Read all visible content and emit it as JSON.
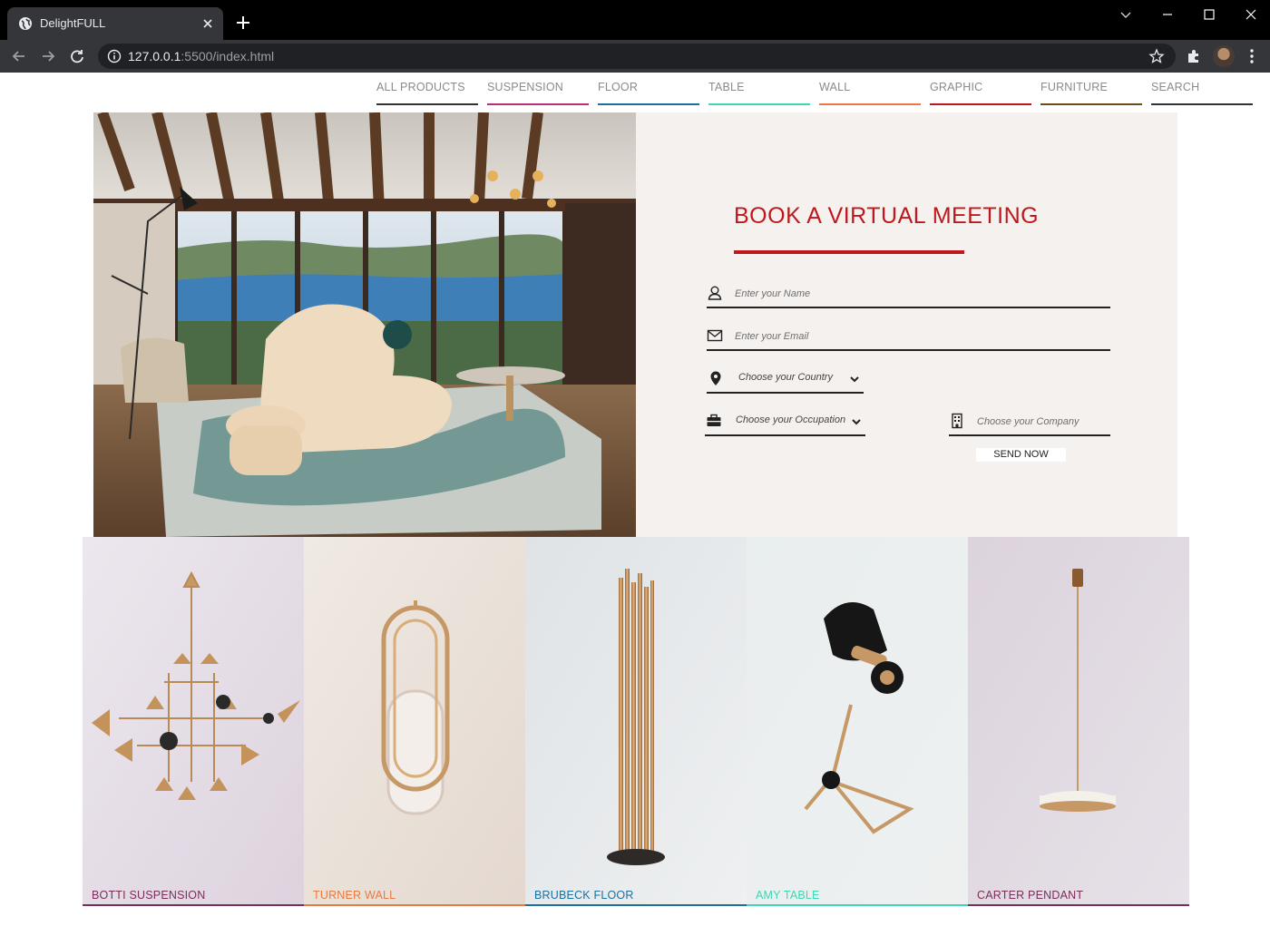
{
  "browser": {
    "tab_title": "DelightFULL",
    "url_host": "127.0.0.1",
    "url_rest": ":5500/index.html"
  },
  "nav": {
    "items": [
      {
        "label": "ALL PRODUCTS",
        "color": "#333333"
      },
      {
        "label": "SUSPENSION",
        "color": "#b5317d"
      },
      {
        "label": "FLOOR",
        "color": "#1d6f9c"
      },
      {
        "label": "TABLE",
        "color": "#3fd6b3"
      },
      {
        "label": "WALL",
        "color": "#e67a45"
      },
      {
        "label": "GRAPHIC",
        "color": "#c0171c"
      },
      {
        "label": "FURNITURE",
        "color": "#6b4a1c"
      },
      {
        "label": "SEARCH",
        "color": "#333333"
      }
    ]
  },
  "form": {
    "heading": "BOOK A VIRTUAL MEETING",
    "accent_color": "#c0171c",
    "name_placeholder": "Enter your Name",
    "email_placeholder": "Enter your Email",
    "country_label": "Choose your Country",
    "occupation_label": "Choose your Occupation",
    "company_placeholder": "Choose your Company",
    "send_label": "SEND NOW"
  },
  "products": [
    {
      "name": "BOTTI SUSPENSION",
      "color": "#7a2e5a"
    },
    {
      "name": "TURNER WALL",
      "color": "#e67a45"
    },
    {
      "name": "BRUBECK FLOOR",
      "color": "#1d6f9c"
    },
    {
      "name": "AMY TABLE",
      "color": "#3fd6b3"
    },
    {
      "name": "CARTER PENDANT",
      "color": "#7a2e5a"
    }
  ]
}
